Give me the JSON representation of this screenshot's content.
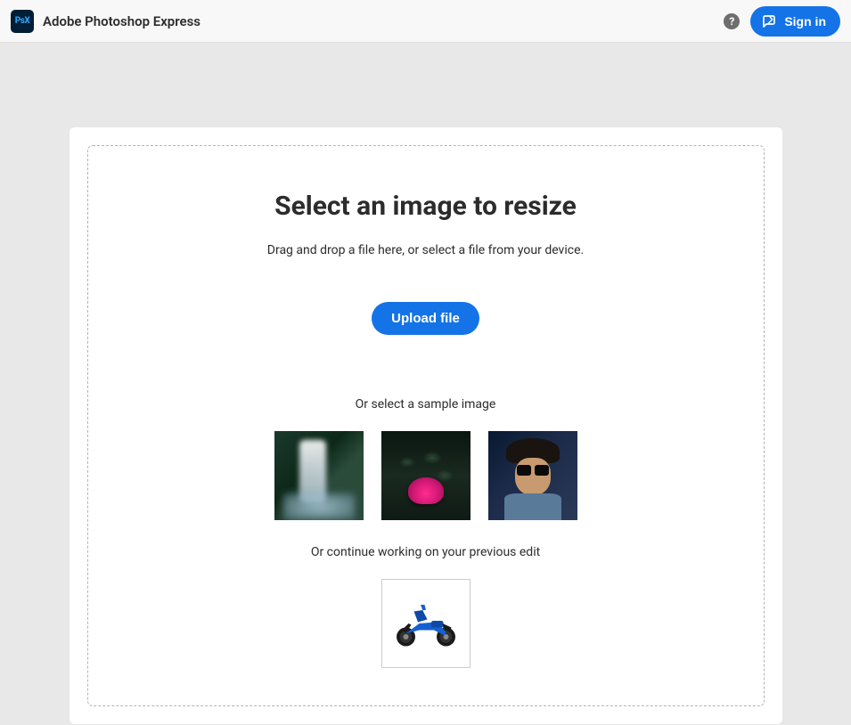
{
  "header": {
    "logo_text": "PsX",
    "app_title": "Adobe Photoshop Express",
    "help_glyph": "?",
    "signin_label": "Sign in"
  },
  "main": {
    "title": "Select an image to resize",
    "subtitle": "Drag and drop a file here, or select a file from your device.",
    "upload_label": "Upload file",
    "sample_label": "Or select a sample image",
    "samples": [
      {
        "name": "waterfall"
      },
      {
        "name": "lotus"
      },
      {
        "name": "portrait"
      }
    ],
    "previous_label": "Or continue working on your previous edit",
    "previous_item": {
      "name": "motorcycle"
    }
  },
  "colors": {
    "primary": "#1473e6"
  }
}
